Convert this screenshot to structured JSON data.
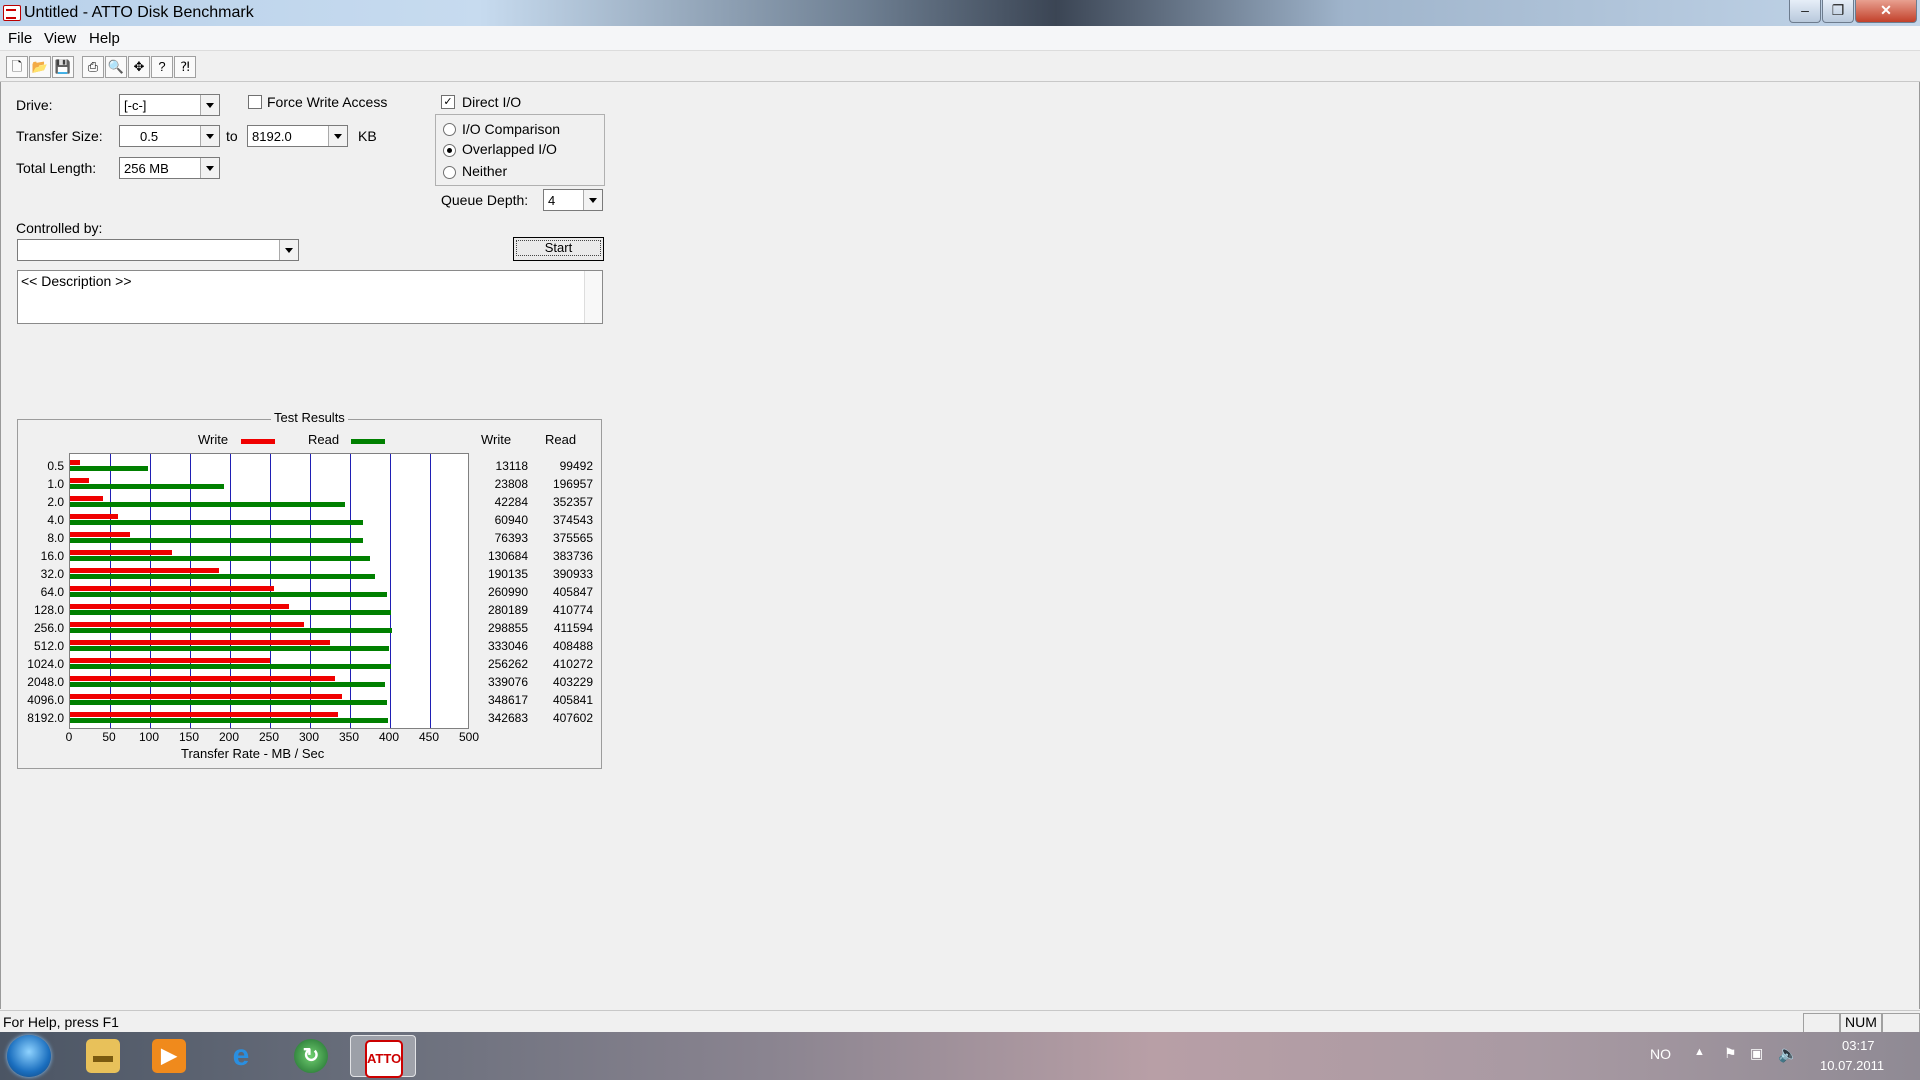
{
  "window": {
    "title": "Untitled - ATTO Disk Benchmark",
    "buttons": {
      "minimize": "–",
      "maximize": "❐",
      "close": "✕"
    }
  },
  "menu": {
    "items": [
      "File",
      "View",
      "Help"
    ]
  },
  "toolbar": {
    "icons": [
      "new-file-icon",
      "open-folder-icon",
      "save-icon",
      "print-icon",
      "print-preview-icon",
      "move-icon",
      "help-icon",
      "context-help-icon"
    ]
  },
  "settings": {
    "drive_label": "Drive:",
    "drive_value": "[-c-]",
    "force_write_label": "Force Write Access",
    "force_write_checked": false,
    "direct_io_label": "Direct I/O",
    "direct_io_checked": true,
    "transfer_size_label": "Transfer Size:",
    "transfer_from": "0.5",
    "to_label": "to",
    "transfer_to": "8192.0",
    "kb_label": "KB",
    "total_length_label": "Total Length:",
    "total_length_value": "256 MB",
    "io_options": [
      {
        "label": "I/O Comparison",
        "selected": false
      },
      {
        "label": "Overlapped I/O",
        "selected": true
      },
      {
        "label": "Neither",
        "selected": false
      }
    ],
    "queue_depth_label": "Queue Depth:",
    "queue_depth_value": "4",
    "controlled_by_label": "Controlled by:",
    "controlled_by_value": "",
    "start_label": "Start",
    "description": "<< Description >>"
  },
  "chart_data": {
    "type": "bar",
    "title": "Test Results",
    "legend": [
      "Write",
      "Read"
    ],
    "colors": {
      "write": "#f00000",
      "read": "#008000",
      "grid": "#1f1fb4"
    },
    "xlabel": "Transfer Rate - MB / Sec",
    "xlim": [
      0,
      500
    ],
    "xticks": [
      "0",
      "50",
      "100",
      "150",
      "200",
      "250",
      "300",
      "350",
      "400",
      "450",
      "500"
    ],
    "categories": [
      "0.5",
      "1.0",
      "2.0",
      "4.0",
      "8.0",
      "16.0",
      "32.0",
      "64.0",
      "128.0",
      "256.0",
      "512.0",
      "1024.0",
      "2048.0",
      "4096.0",
      "8192.0"
    ],
    "column_headers": [
      "Write",
      "Read"
    ],
    "write_kb": [
      "13118",
      "23808",
      "42284",
      "60940",
      "76393",
      "130684",
      "190135",
      "260990",
      "280189",
      "298855",
      "333046",
      "256262",
      "339076",
      "348617",
      "342683"
    ],
    "read_kb": [
      "99492",
      "196957",
      "352357",
      "374543",
      "375565",
      "383736",
      "390933",
      "405847",
      "410774",
      "411594",
      "408488",
      "410272",
      "403229",
      "405841",
      "407602"
    ],
    "series": [
      {
        "name": "Write",
        "values": [
          12.8,
          23.3,
          41.3,
          59.5,
          74.6,
          127.6,
          185.7,
          254.9,
          273.6,
          291.9,
          325.2,
          250.3,
          331.1,
          340.4,
          334.6
        ]
      },
      {
        "name": "Read",
        "values": [
          97.2,
          192.3,
          344.1,
          365.8,
          366.8,
          374.7,
          381.8,
          396.3,
          401.1,
          401.9,
          398.9,
          400.7,
          393.8,
          396.3,
          398.0
        ]
      }
    ]
  },
  "statusbar": {
    "help_text": "For Help, press F1",
    "num": "NUM"
  },
  "taskbar": {
    "apps": [
      "windows-explorer",
      "media-player",
      "internet-explorer",
      "network-app",
      "atto-disk-benchmark"
    ],
    "language": "NO",
    "time": "03:17",
    "date": "10.07.2011"
  }
}
